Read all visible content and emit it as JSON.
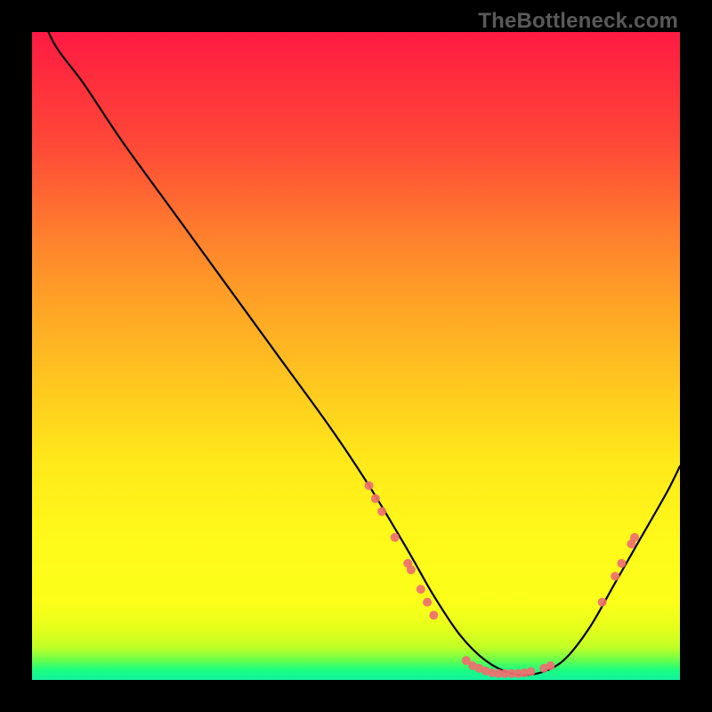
{
  "watermark": "TheBottleneck.com",
  "chart_data": {
    "type": "line",
    "title": "",
    "xlabel": "",
    "ylabel": "",
    "xlim": [
      0,
      100
    ],
    "ylim": [
      0,
      100
    ],
    "series": [
      {
        "name": "curve",
        "x": [
          0,
          3,
          8,
          14,
          22,
          30,
          38,
          46,
          52,
          58,
          62,
          66,
          70,
          74,
          78,
          82,
          86,
          90,
          94,
          98,
          100
        ],
        "y": [
          108,
          99,
          92,
          83,
          72,
          61,
          50,
          39,
          30,
          20,
          13,
          7,
          3,
          1,
          1,
          3,
          8,
          15,
          22,
          29,
          33
        ]
      }
    ],
    "markers": [
      {
        "x": 52,
        "y": 30
      },
      {
        "x": 53,
        "y": 28
      },
      {
        "x": 54,
        "y": 26
      },
      {
        "x": 56,
        "y": 22
      },
      {
        "x": 58,
        "y": 18
      },
      {
        "x": 58.5,
        "y": 17
      },
      {
        "x": 60,
        "y": 14
      },
      {
        "x": 61,
        "y": 12
      },
      {
        "x": 62,
        "y": 10
      },
      {
        "x": 67,
        "y": 3
      },
      {
        "x": 68,
        "y": 2.2
      },
      {
        "x": 69,
        "y": 1.8
      },
      {
        "x": 70,
        "y": 1.4
      },
      {
        "x": 71,
        "y": 1.1
      },
      {
        "x": 72,
        "y": 1.0
      },
      {
        "x": 73,
        "y": 1.0
      },
      {
        "x": 74,
        "y": 1.0
      },
      {
        "x": 75,
        "y": 1.0
      },
      {
        "x": 76,
        "y": 1.1
      },
      {
        "x": 77,
        "y": 1.3
      },
      {
        "x": 79,
        "y": 1.8
      },
      {
        "x": 80,
        "y": 2.2
      },
      {
        "x": 88,
        "y": 12
      },
      {
        "x": 90,
        "y": 16
      },
      {
        "x": 91,
        "y": 18
      },
      {
        "x": 92.5,
        "y": 21
      },
      {
        "x": 93,
        "y": 22
      }
    ],
    "marker_radius": 5,
    "note": "Values estimated from pixel positions; y is percentage of plot height from bottom."
  }
}
